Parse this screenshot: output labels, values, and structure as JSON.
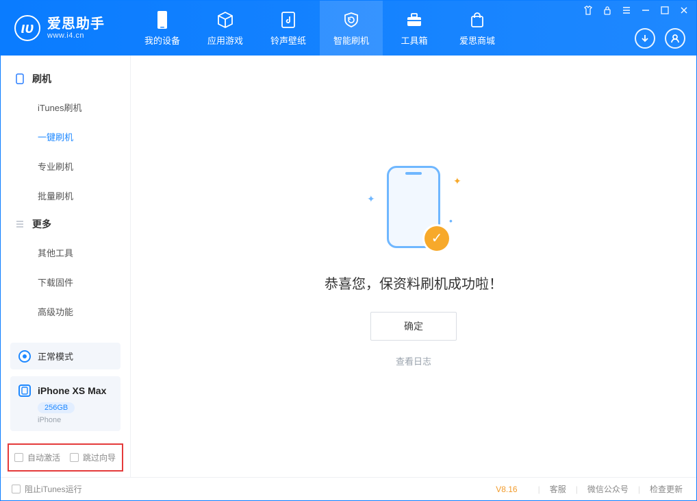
{
  "app": {
    "title": "爱思助手",
    "subtitle": "www.i4.cn"
  },
  "nav": {
    "items": [
      {
        "label": "我的设备"
      },
      {
        "label": "应用游戏"
      },
      {
        "label": "铃声壁纸"
      },
      {
        "label": "智能刷机"
      },
      {
        "label": "工具箱"
      },
      {
        "label": "爱思商城"
      }
    ],
    "active_index": 3
  },
  "sidebar": {
    "group1": {
      "title": "刷机",
      "items": [
        {
          "label": "iTunes刷机"
        },
        {
          "label": "一键刷机"
        },
        {
          "label": "专业刷机"
        },
        {
          "label": "批量刷机"
        }
      ],
      "active_index": 1
    },
    "group2": {
      "title": "更多",
      "items": [
        {
          "label": "其他工具"
        },
        {
          "label": "下载固件"
        },
        {
          "label": "高级功能"
        }
      ]
    },
    "status": {
      "label": "正常模式"
    },
    "device": {
      "name": "iPhone XS Max",
      "capacity": "256GB",
      "type": "iPhone"
    },
    "bottom_checks": {
      "auto_activate": "自动激活",
      "skip_guide": "跳过向导"
    }
  },
  "main": {
    "success_message": "恭喜您，保资料刷机成功啦！",
    "ok_button": "确定",
    "view_log": "查看日志"
  },
  "footer": {
    "block_itunes": "阻止iTunes运行",
    "version": "V8.16",
    "links": {
      "support": "客服",
      "wechat": "微信公众号",
      "check_update": "检查更新"
    }
  }
}
